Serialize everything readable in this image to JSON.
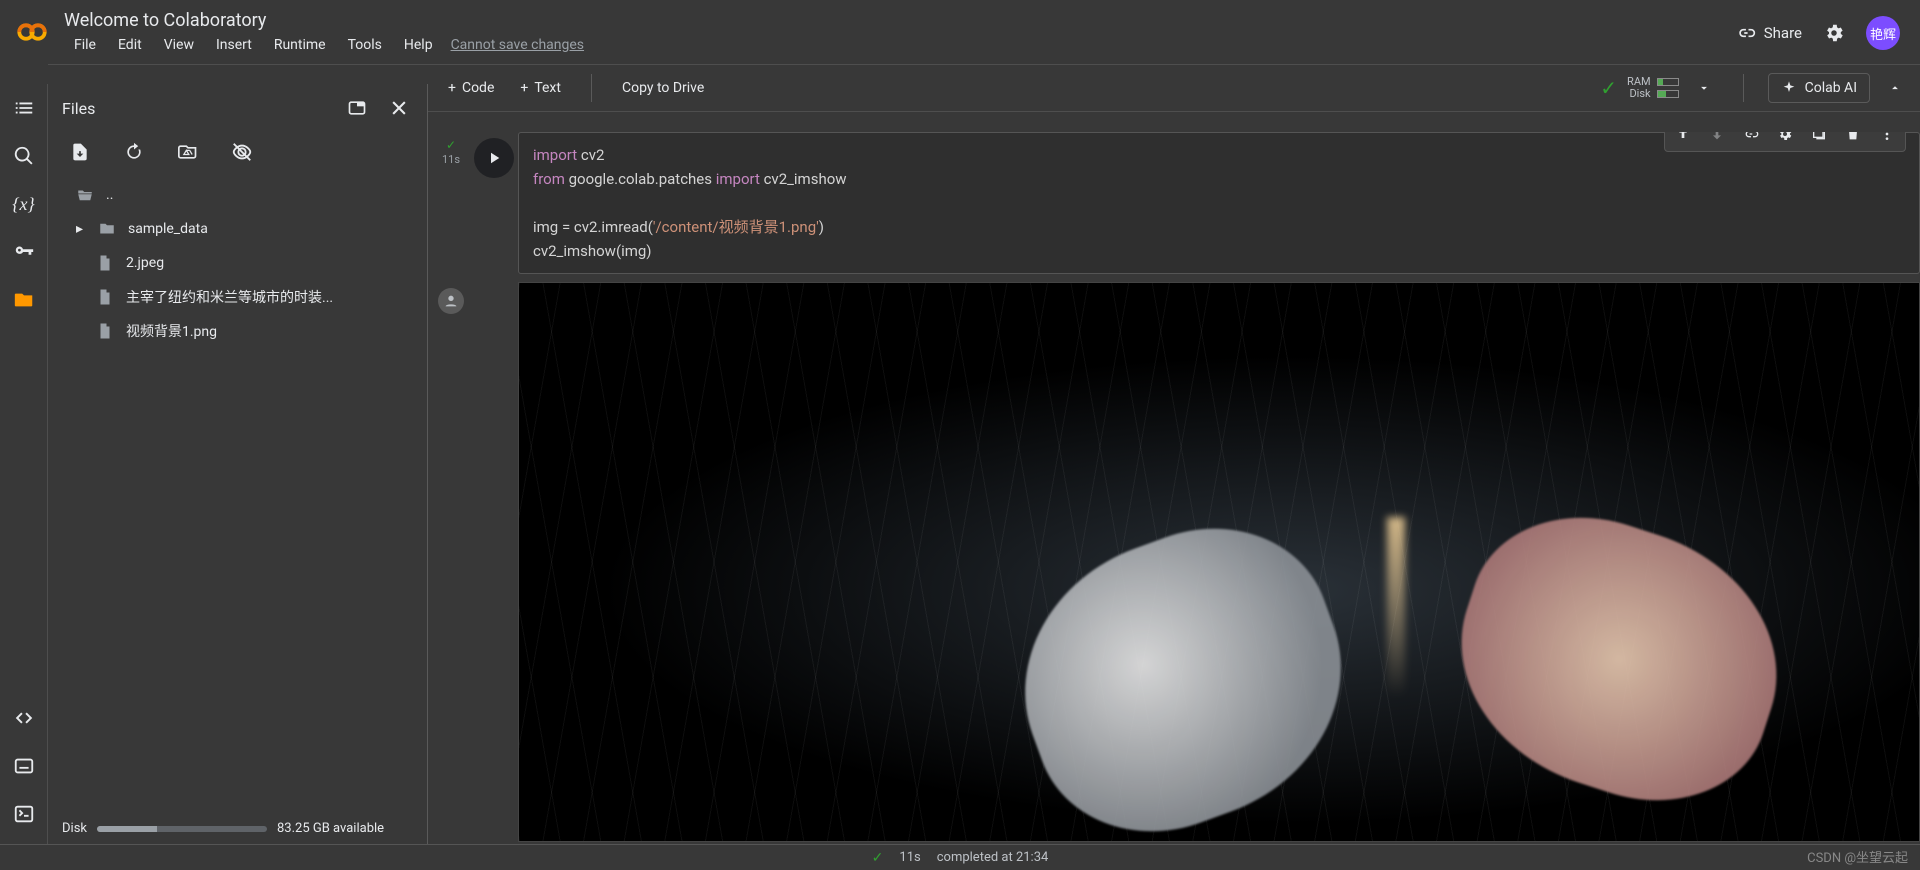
{
  "header": {
    "title": "Welcome to Colaboratory",
    "menu": [
      "File",
      "Edit",
      "View",
      "Insert",
      "Runtime",
      "Tools",
      "Help"
    ],
    "note": "Cannot save changes",
    "share": "Share",
    "avatar": "艳辉"
  },
  "toolbar": {
    "code": "Code",
    "text": "Text",
    "copy": "Copy to Drive",
    "ram": "RAM",
    "disk": "Disk",
    "ai": "Colab AI"
  },
  "files": {
    "title": "Files",
    "parent": "..",
    "items": [
      {
        "name": "sample_data",
        "type": "folder"
      },
      {
        "name": "2.jpeg",
        "type": "file"
      },
      {
        "name": "主宰了纽约和米兰等城市的时装...",
        "type": "file"
      },
      {
        "name": "视频背景1.png",
        "type": "file"
      }
    ],
    "disk_label": "Disk",
    "disk_avail": "83.25 GB available"
  },
  "cell": {
    "exec_time": "11s",
    "code_tokens": {
      "l1a": "import",
      "l1b": " cv2",
      "l2a": "from",
      "l2b": " google.colab.patches ",
      "l2c": "import",
      "l2d": " cv2_imshow",
      "l3": "",
      "l4a": "img = cv2.imread(",
      "l4b": "'/content/视频背景1.png'",
      "l4c": ")",
      "l5": "cv2_imshow(img)"
    }
  },
  "status": {
    "time": "11s",
    "msg": "completed at 21:34"
  },
  "watermark": "CSDN @坐望云起"
}
